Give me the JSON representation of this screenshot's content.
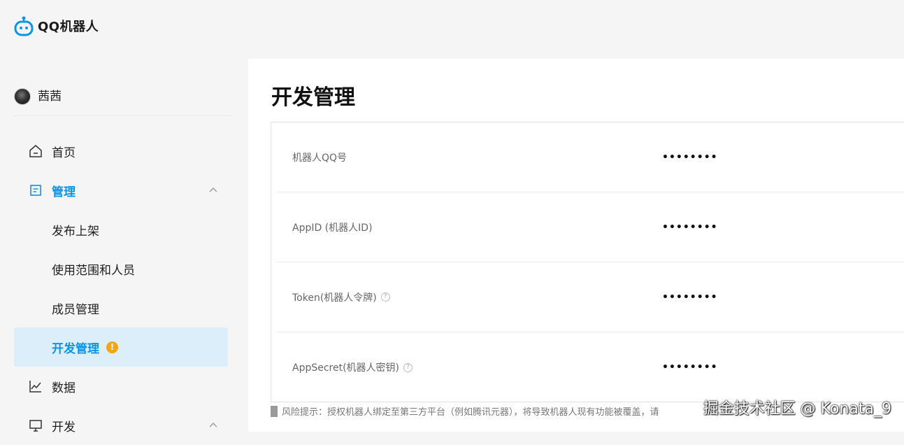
{
  "brand": {
    "name": "QQ机器人",
    "accent": "#0a95e8"
  },
  "user": {
    "name": "茜茜"
  },
  "nav": {
    "home": {
      "label": "首页",
      "icon": "home-icon"
    },
    "manage": {
      "label": "管理",
      "icon": "document-icon",
      "expanded": true,
      "children": {
        "publish": "发布上架",
        "scope": "使用范围和人员",
        "members": "成员管理",
        "dev": "开发管理"
      },
      "dev_badge": "!"
    },
    "data": {
      "label": "数据",
      "icon": "chart-icon"
    },
    "develop": {
      "label": "开发",
      "icon": "monitor-icon",
      "expanded": true
    }
  },
  "main": {
    "title": "开发管理",
    "rows": [
      {
        "label": "机器人QQ号",
        "value": "••••••••"
      },
      {
        "label": "AppID (机器人ID)",
        "value": "••••••••"
      },
      {
        "label": "Token(机器人令牌)",
        "value": "••••••••",
        "help": "?"
      },
      {
        "label": "AppSecret(机器人密钥)",
        "value": "••••••••",
        "help": "?"
      }
    ],
    "risk_notice": "风险提示：授权机器人绑定至第三方平台（例如腾讯元器），将导致机器人现有功能被覆盖，请"
  },
  "watermark": "掘金技术社区 @ Konata_9",
  "colors": {
    "selected_bg": "#ddeefb",
    "badge": "#f4a417",
    "page_bg": "#f5f5f6"
  }
}
